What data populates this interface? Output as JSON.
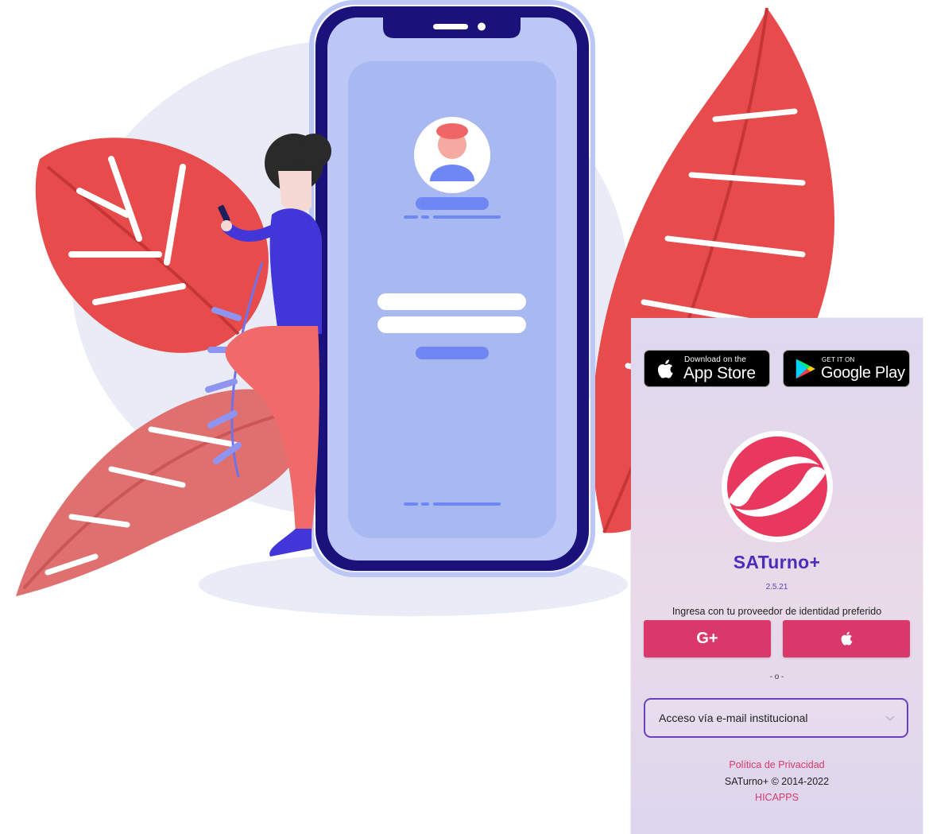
{
  "colors": {
    "accent": "#d9386a",
    "brand_purple": "#4b2dbb",
    "select_border": "#6a3fc0",
    "leaf_red": "#e84b4b",
    "phone_frame": "#1a127a",
    "phone_screen": "#a8b8f0"
  },
  "illustration": {
    "description_icon": "person-leaning-on-phone-illustration"
  },
  "stores": {
    "appstore": {
      "small": "Download on the",
      "big": "App Store",
      "icon": "apple-icon"
    },
    "gplay": {
      "small": "GET IT ON",
      "big": "Google Play",
      "icon": "google-play-icon"
    }
  },
  "app": {
    "name": "SATurno+",
    "version": "2.5.21",
    "login_hint": "Ingresa con tu proveedor de identidad preferido"
  },
  "providers": {
    "google": {
      "label": "G+",
      "icon": "google-plus-icon"
    },
    "apple": {
      "icon": "apple-icon"
    }
  },
  "divider": "- o -",
  "select": {
    "value": "Acceso vía e-mail institucional",
    "icon": "chevron-down-icon"
  },
  "footer": {
    "privacy": "Política de Privacidad",
    "copyright": "SATurno+ © 2014-2022",
    "company": "HICAPPS"
  }
}
